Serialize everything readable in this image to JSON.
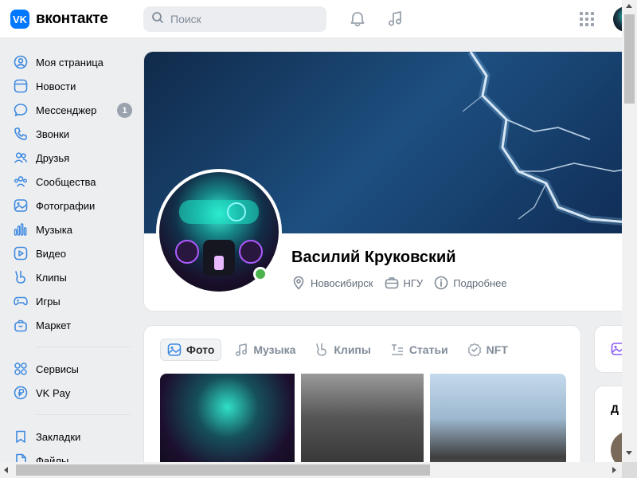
{
  "header": {
    "logo_mark": "VK",
    "logo_text": "вконтакте",
    "search_placeholder": "Поиск"
  },
  "sidebar": {
    "items": [
      {
        "label": "Моя страница",
        "icon": "user-circle-icon"
      },
      {
        "label": "Новости",
        "icon": "news-icon"
      },
      {
        "label": "Мессенджер",
        "icon": "message-icon",
        "badge": "1"
      },
      {
        "label": "Звонки",
        "icon": "phone-icon"
      },
      {
        "label": "Друзья",
        "icon": "users-icon"
      },
      {
        "label": "Сообщества",
        "icon": "communities-icon"
      },
      {
        "label": "Фотографии",
        "icon": "photo-icon"
      },
      {
        "label": "Музыка",
        "icon": "music-icon"
      },
      {
        "label": "Видео",
        "icon": "video-icon"
      },
      {
        "label": "Клипы",
        "icon": "clips-icon"
      },
      {
        "label": "Игры",
        "icon": "gamepad-icon"
      },
      {
        "label": "Маркет",
        "icon": "market-icon"
      }
    ],
    "items2": [
      {
        "label": "Сервисы",
        "icon": "services-icon"
      },
      {
        "label": "VK Pay",
        "icon": "vkpay-icon"
      }
    ],
    "items3": [
      {
        "label": "Закладки",
        "icon": "bookmark-icon"
      },
      {
        "label": "Файлы",
        "icon": "file-icon"
      }
    ]
  },
  "profile": {
    "name": "Василий Круковский",
    "city": "Новосибирск",
    "university": "НГУ",
    "more": "Подробнее",
    "online": true
  },
  "content_tabs": [
    {
      "label": "Фото",
      "icon": "photo-icon",
      "active": true
    },
    {
      "label": "Музыка",
      "icon": "music-icon",
      "active": false
    },
    {
      "label": "Клипы",
      "icon": "clips-icon",
      "active": false
    },
    {
      "label": "Статьи",
      "icon": "article-icon",
      "active": false
    },
    {
      "label": "NFT",
      "icon": "nft-icon",
      "active": false
    }
  ],
  "side": {
    "friends_title_partial": "Д"
  },
  "colors": {
    "accent": "#0077ff",
    "online": "#4bb34b",
    "badge": "#99a2ad",
    "muted_text": "#818c99"
  }
}
